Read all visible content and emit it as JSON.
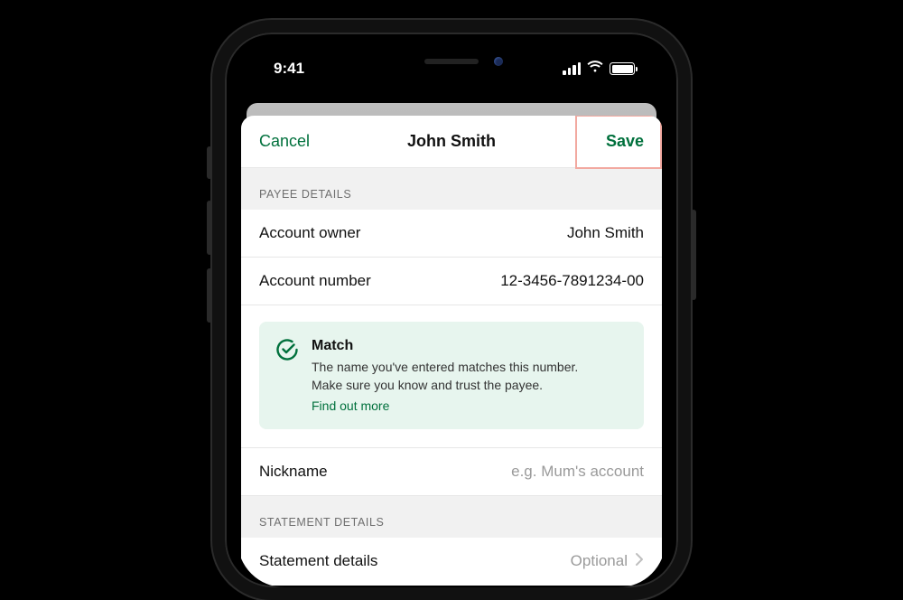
{
  "status": {
    "time": "9:41"
  },
  "nav": {
    "cancel": "Cancel",
    "title": "John Smith",
    "save": "Save"
  },
  "sections": {
    "payee_header": "PAYEE DETAILS",
    "statement_header": "STATEMENT DETAILS"
  },
  "payee": {
    "owner_label": "Account owner",
    "owner_value": "John Smith",
    "number_label": "Account number",
    "number_value": "12-3456-7891234-00",
    "nickname_label": "Nickname",
    "nickname_placeholder": "e.g. Mum's account"
  },
  "match": {
    "title": "Match",
    "text1": "The name you've entered matches this number.",
    "text2": "Make sure you know and trust the payee.",
    "link": "Find out more"
  },
  "statement": {
    "label": "Statement details",
    "value": "Optional"
  },
  "colors": {
    "accent": "#00703c",
    "match_bg": "#e7f5ee",
    "highlight_border": "#f2a9a0"
  }
}
